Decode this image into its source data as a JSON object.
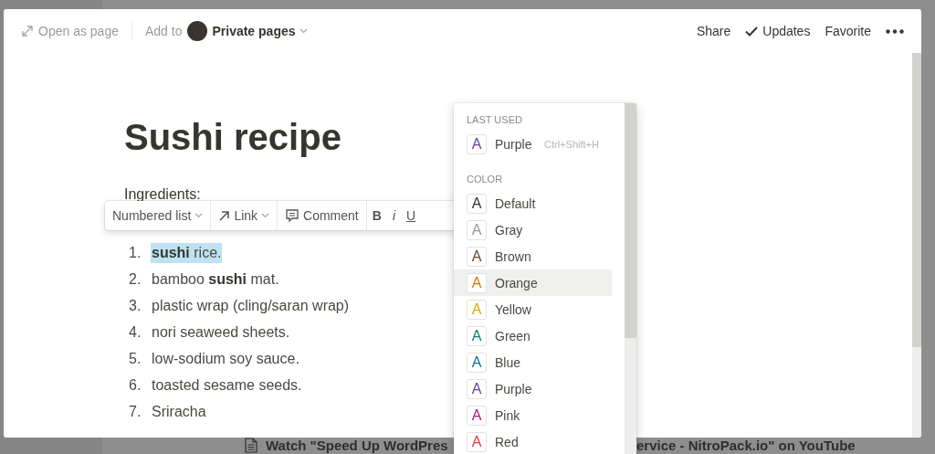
{
  "header": {
    "open_as_page": "Open as page",
    "add_to": "Add to",
    "location": "Private pages",
    "actions": [
      {
        "kind": "text",
        "label": "Share"
      },
      {
        "kind": "check",
        "label": "Updates"
      },
      {
        "kind": "text",
        "label": "Favorite"
      },
      {
        "kind": "more"
      }
    ]
  },
  "page": {
    "title": "Sushi recipe",
    "subheading": "Ingredients:",
    "list": [
      {
        "number": "1.",
        "text": "**sushi** rice.",
        "highlighted": true
      },
      {
        "number": "2.",
        "text": "bamboo **sushi** mat.",
        "highlighted": false
      },
      {
        "number": "3.",
        "text": "plastic wrap (cling/saran wrap)",
        "highlighted": false
      },
      {
        "number": "4.",
        "text": "nori seaweed sheets.",
        "highlighted": false
      },
      {
        "number": "5.",
        "text": "low-sodium soy sauce.",
        "highlighted": false
      },
      {
        "number": "6.",
        "text": "toasted sesame seeds.",
        "highlighted": false
      },
      {
        "number": "7.",
        "text": "Sriracha",
        "highlighted": false
      }
    ]
  },
  "toolbar": [
    {
      "kind": "dropdown",
      "label": "Numbered list"
    },
    {
      "kind": "link",
      "label": "Link"
    },
    {
      "kind": "comment",
      "label": "Comment"
    },
    {
      "kind": "bold",
      "label": "B"
    },
    {
      "kind": "italic",
      "label": "i"
    },
    {
      "kind": "underline",
      "label": "U"
    }
  ],
  "color_menu": {
    "sections": [
      {
        "heading": "LAST USED",
        "items": [
          {
            "swatch": "A",
            "label": "Purple",
            "color": "#6940a5",
            "shortcut": "Ctrl+Shift+H",
            "selected": false
          }
        ]
      },
      {
        "heading": "COLOR",
        "items": [
          {
            "swatch": "A",
            "label": "Default",
            "color": "#37352f",
            "selected": false
          },
          {
            "swatch": "A",
            "label": "Gray",
            "color": "#9b9a97",
            "selected": false
          },
          {
            "swatch": "A",
            "label": "Brown",
            "color": "#64473a",
            "selected": false
          },
          {
            "swatch": "A",
            "label": "Orange",
            "color": "#d9730d",
            "selected": true
          },
          {
            "swatch": "A",
            "label": "Yellow",
            "color": "#dfab01",
            "selected": false
          },
          {
            "swatch": "A",
            "label": "Green",
            "color": "#0f7b6c",
            "selected": false
          },
          {
            "swatch": "A",
            "label": "Blue",
            "color": "#0b6e99",
            "selected": false
          },
          {
            "swatch": "A",
            "label": "Purple",
            "color": "#6940a5",
            "selected": false
          },
          {
            "swatch": "A",
            "label": "Pink",
            "color": "#ad1a72",
            "selected": false
          },
          {
            "swatch": "A",
            "label": "Red",
            "color": "#e03e3e",
            "selected": false
          }
        ]
      }
    ]
  },
  "background": {
    "texts": [
      "Watch \"Speed Up WordPres",
      "ervice - NitroPack.io\" on YouTube"
    ]
  }
}
